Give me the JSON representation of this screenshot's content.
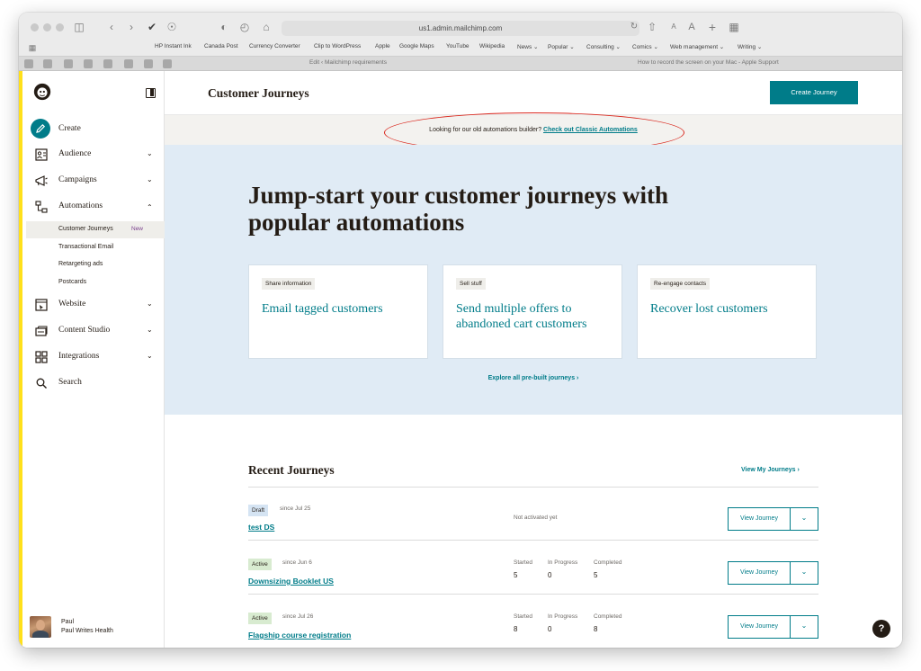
{
  "browser": {
    "url": "us1.admin.mailchimp.com",
    "bookmarks": [
      "HP Instant Ink",
      "Canada Post",
      "Currency Converter",
      "Clip to WordPress",
      "Apple",
      "Google Maps",
      "YouTube",
      "Wikipedia",
      "News ⌄",
      "Popular ⌄",
      "Consulting ⌄",
      "Comics ⌄",
      "Web management ⌄",
      "Writing ⌄"
    ],
    "tabs": [
      "Edit ‹ Mailchimp requirements",
      "How to record the screen on your Mac - Apple Support"
    ]
  },
  "sidebar": {
    "create_label": "Create",
    "items": [
      {
        "label": "Audience",
        "icon": "audience-icon"
      },
      {
        "label": "Campaigns",
        "icon": "campaigns-icon"
      },
      {
        "label": "Automations",
        "icon": "automations-icon"
      },
      {
        "label": "Website",
        "icon": "website-icon"
      },
      {
        "label": "Content Studio",
        "icon": "content-studio-icon"
      },
      {
        "label": "Integrations",
        "icon": "integrations-icon"
      },
      {
        "label": "Search",
        "icon": "search-icon"
      }
    ],
    "subitems": [
      {
        "label": "Customer Journeys"
      },
      {
        "label": "Transactional Email"
      },
      {
        "label": "Retargeting ads"
      },
      {
        "label": "Postcards"
      }
    ],
    "new_badge": "New",
    "profile": {
      "name": "Paul",
      "account": "Paul Writes Health"
    }
  },
  "header": {
    "title": "Customer Journeys",
    "create_button": "Create Journey"
  },
  "notice": {
    "text": "Looking for our old automations builder?",
    "link": "Check out Classic Automations"
  },
  "hero": {
    "title": "Jump-start your customer journeys with popular automations",
    "cards": [
      {
        "tag": "Share information",
        "title": "Email tagged customers"
      },
      {
        "tag": "Sell stuff",
        "title": "Send multiple offers to abandoned cart customers"
      },
      {
        "tag": "Re-engage contacts",
        "title": "Recover lost customers"
      }
    ],
    "explore_link": "Explore all pre-built journeys ›"
  },
  "recent": {
    "title": "Recent Journeys",
    "view_all": "View My Journeys ›",
    "stat_labels": {
      "started": "Started",
      "in_progress": "In Progress",
      "completed": "Completed"
    },
    "view_button": "View Journey",
    "journeys": [
      {
        "status": "Draft",
        "since": "since Jul 25",
        "name": "test DS",
        "note": "Not activated yet"
      },
      {
        "status": "Active",
        "since": "since Jun 6",
        "name": "Downsizing Booklet US",
        "started": "5",
        "in_progress": "0",
        "completed": "5"
      },
      {
        "status": "Active",
        "since": "since Jul 26",
        "name": "Flagship course registration",
        "started": "8",
        "in_progress": "0",
        "completed": "8"
      }
    ]
  },
  "help": {
    "label": "?"
  },
  "colors": {
    "accent": "#007c89",
    "brand_yellow": "#ffe01b",
    "hero_bg": "#e0ebf5",
    "annotation_red": "#d9261c"
  }
}
